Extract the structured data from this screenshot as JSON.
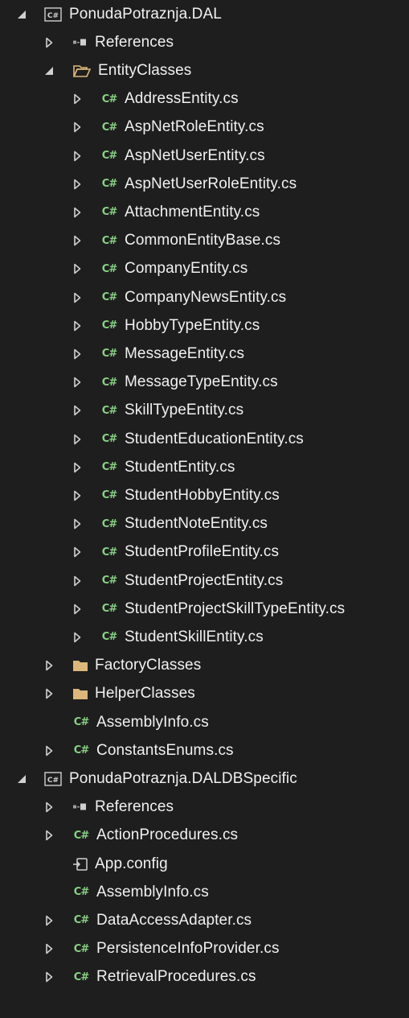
{
  "projects": [
    {
      "name": "PonudaPotraznja.DAL",
      "items": [
        {
          "type": "references",
          "label": "References"
        },
        {
          "type": "folder",
          "open": true,
          "label": "EntityClasses",
          "children": [
            "AddressEntity.cs",
            "AspNetRoleEntity.cs",
            "AspNetUserEntity.cs",
            "AspNetUserRoleEntity.cs",
            "AttachmentEntity.cs",
            "CommonEntityBase.cs",
            "CompanyEntity.cs",
            "CompanyNewsEntity.cs",
            "HobbyTypeEntity.cs",
            "MessageEntity.cs",
            "MessageTypeEntity.cs",
            "SkillTypeEntity.cs",
            "StudentEducationEntity.cs",
            "StudentEntity.cs",
            "StudentHobbyEntity.cs",
            "StudentNoteEntity.cs",
            "StudentProfileEntity.cs",
            "StudentProjectEntity.cs",
            "StudentProjectSkillTypeEntity.cs",
            "StudentSkillEntity.cs"
          ]
        },
        {
          "type": "folder",
          "open": false,
          "label": "FactoryClasses"
        },
        {
          "type": "folder",
          "open": false,
          "label": "HelperClasses"
        },
        {
          "type": "cs",
          "expandable": false,
          "label": "AssemblyInfo.cs"
        },
        {
          "type": "cs",
          "expandable": true,
          "label": "ConstantsEnums.cs"
        }
      ]
    },
    {
      "name": "PonudaPotraznja.DALDBSpecific",
      "items": [
        {
          "type": "references",
          "label": "References"
        },
        {
          "type": "cs",
          "expandable": true,
          "label": "ActionProcedures.cs"
        },
        {
          "type": "config",
          "expandable": false,
          "label": "App.config"
        },
        {
          "type": "cs",
          "expandable": false,
          "label": "AssemblyInfo.cs"
        },
        {
          "type": "cs",
          "expandable": true,
          "label": "DataAccessAdapter.cs"
        },
        {
          "type": "cs",
          "expandable": true,
          "label": "PersistenceInfoProvider.cs"
        },
        {
          "type": "cs",
          "expandable": true,
          "label": "RetrievalProcedures.cs"
        }
      ]
    }
  ],
  "icon_text": {
    "csharp": "C#"
  },
  "colors": {
    "background": "#1e1e1e",
    "text": "#f1f1f1",
    "csharp": "#89d185",
    "folder": "#dcb67a",
    "arrow": "#d0d0d0"
  }
}
